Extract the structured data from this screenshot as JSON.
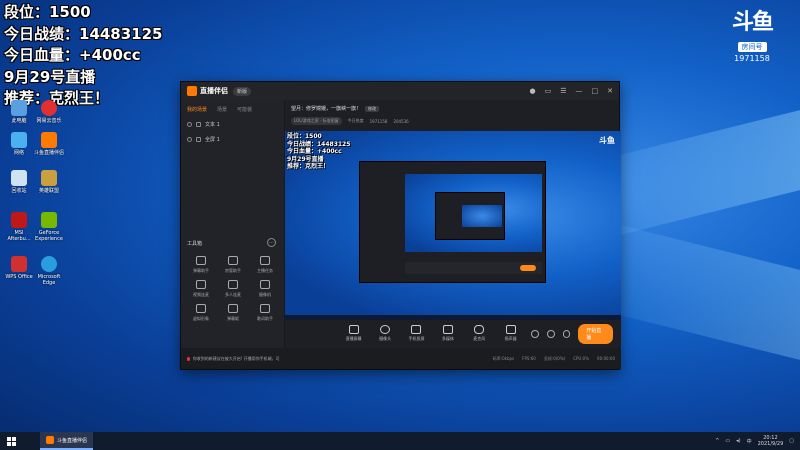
{
  "overlay": {
    "line1": "段位：1500",
    "line2": "今日战绩：14483125",
    "line3": "今日血量：+400cc",
    "line4": "9月29号直播",
    "line5": "推荐：克烈王！"
  },
  "douyu": {
    "logo": "斗鱼",
    "room_tag": "房间号",
    "room_id": "1971158"
  },
  "desktop_icons": [
    {
      "label": "此电脑",
      "icon": "computer-icon",
      "color": "#5aa0e0"
    },
    {
      "label": "网易云音乐",
      "icon": "music-icon",
      "color": "#e03030"
    },
    {
      "label": "网络",
      "icon": "network-icon",
      "color": "#4ab0f0"
    },
    {
      "label": "斗鱼直播伴侣",
      "icon": "douyu-icon",
      "color": "#ff7a00"
    },
    {
      "label": "回收站",
      "icon": "recycle-bin-icon",
      "color": "#cfe3f5"
    },
    {
      "label": "英雄联盟",
      "icon": "game-icon",
      "color": "#c8a040"
    },
    {
      "label": "MSI Afterbu...",
      "icon": "msi-icon",
      "color": "#c01818"
    },
    {
      "label": "GeForce Experience",
      "icon": "nvidia-icon",
      "color": "#76b900"
    },
    {
      "label": "WPS Office",
      "icon": "wps-icon",
      "color": "#d03030"
    },
    {
      "label": "Microsoft Edge",
      "icon": "edge-icon",
      "color": "#2a9de0"
    }
  ],
  "app": {
    "title": "直播伴侣",
    "badge": "新版",
    "sidebar": {
      "tabs": [
        "我的场景",
        "场景",
        "可能装"
      ],
      "scenes": [
        "文本 1",
        "全屏 1"
      ],
      "toolbox_title": "工具箱",
      "tools": [
        "弹幕助手",
        "房管助手",
        "主播任务",
        "视频连麦",
        "多人连麦",
        "摄像机",
        "虚拟形象",
        "弹幕姬",
        "歌词助手",
        "语音连麦",
        "抽奖",
        "..."
      ]
    },
    "room": {
      "title": "望月：修罗嫦娥，一旗峡一旗！",
      "edit": "修改",
      "category": "LOL/游戏之家 · 标准图窗",
      "room_id": "1971158",
      "hot": "今日热度",
      "fans": "204536"
    },
    "preview_overlay": [
      "段位：1500",
      "今日战绩：14483125",
      "今日血量：+400cc",
      "9月29号直播",
      "推荐：克烈王！"
    ],
    "controls": [
      {
        "label": "直播屏幕",
        "name": "screen-capture"
      },
      {
        "label": "摄像头",
        "name": "camera"
      },
      {
        "label": "手机投屏",
        "name": "phone-cast"
      },
      {
        "label": "多媒体",
        "name": "media"
      },
      {
        "label": "麦克风",
        "name": "microphone"
      },
      {
        "label": "扬声器",
        "name": "speaker"
      }
    ],
    "start_live": "开始直播",
    "notice": "你收到的新建议在被大开启! 开播用你手机端，可以使用多种方式点击",
    "status": {
      "bitrate": "码率:0kbps",
      "fps": "FPS:60",
      "drop": "丢帧:0(0%)",
      "cpu": "CPU:0%",
      "time": "00:00:00"
    }
  },
  "taskbar": {
    "app_label": "斗鱼直播伴侣",
    "time": "20:12",
    "date": "2021/9/29"
  }
}
